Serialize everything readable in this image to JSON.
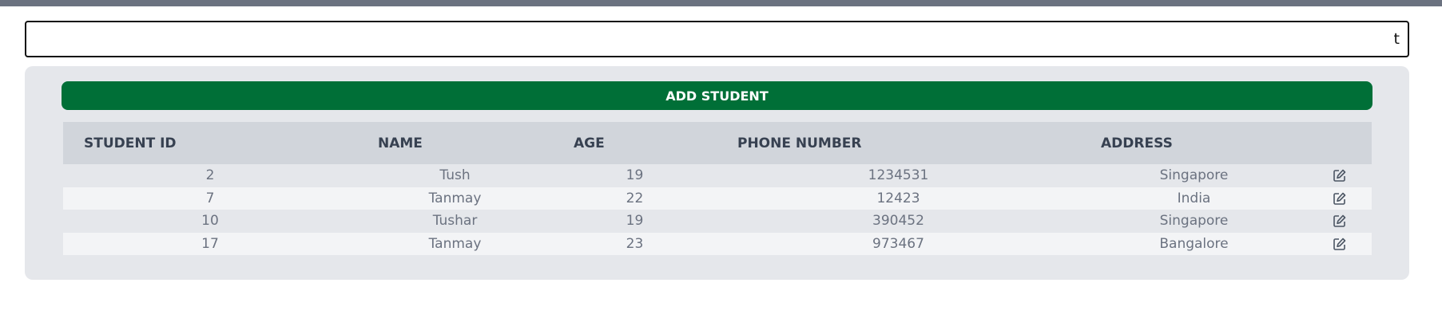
{
  "search": {
    "value": "t",
    "placeholder": ""
  },
  "add_button": {
    "label": "ADD STUDENT"
  },
  "table": {
    "headers": [
      "STUDENT ID",
      "NAME",
      "AGE",
      "PHONE NUMBER",
      "ADDRESS"
    ],
    "rows": [
      {
        "id": "2",
        "name": "Tush",
        "age": "19",
        "phone": "1234531",
        "address": "Singapore"
      },
      {
        "id": "7",
        "name": "Tanmay",
        "age": "22",
        "phone": "12423",
        "address": "India"
      },
      {
        "id": "10",
        "name": "Tushar",
        "age": "19",
        "phone": "390452",
        "address": "Singapore"
      },
      {
        "id": "17",
        "name": "Tanmay",
        "age": "23",
        "phone": "973467",
        "address": "Bangalore"
      }
    ]
  },
  "icons": {
    "row_action": "edit-icon"
  },
  "colors": {
    "topbar": "#6b7280",
    "add_button_bg": "#006f37",
    "panel_bg": "#e5e7eb",
    "header_bg": "#d1d5db"
  }
}
